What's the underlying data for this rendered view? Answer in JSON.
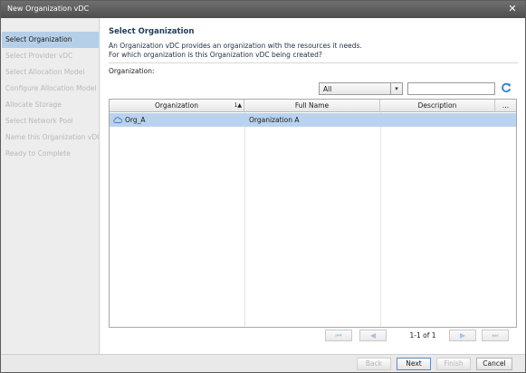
{
  "window": {
    "title": "New Organization vDC",
    "close_glyph": "✕"
  },
  "steps": [
    {
      "label": "Select Organization",
      "active": true
    },
    {
      "label": "Select Provider vDC",
      "active": false
    },
    {
      "label": "Select Allocation Model",
      "active": false
    },
    {
      "label": "Configure Allocation Model",
      "active": false
    },
    {
      "label": "Allocate Storage",
      "active": false
    },
    {
      "label": "Select Network Pool",
      "active": false
    },
    {
      "label": "Name this Organization vDC",
      "active": false
    },
    {
      "label": "Ready to Complete",
      "active": false
    }
  ],
  "main": {
    "heading": "Select Organization",
    "desc_line1": "An Organization vDC provides an organization with the resources it needs.",
    "desc_line2": "For which organization is this Organization vDC being created?",
    "org_label": "Organization:"
  },
  "filter": {
    "selected": "All",
    "arrow_glyph": "▾",
    "search_value": ""
  },
  "table": {
    "columns": [
      {
        "label": "Organization",
        "sort": "1▲"
      },
      {
        "label": "Full Name"
      },
      {
        "label": "Description"
      },
      {
        "label": "..."
      }
    ],
    "rows": [
      {
        "organization": "Org_A",
        "full_name": "Organization A",
        "description": ""
      }
    ]
  },
  "pager": {
    "info": "1-1 of 1",
    "first": "⏮",
    "prev": "◀",
    "next": "▶",
    "last": "⏭"
  },
  "buttons": {
    "back": "Back",
    "next": "Next",
    "finish": "Finish",
    "cancel": "Cancel"
  },
  "colors": {
    "selection": "#b9d3ee",
    "accent": "#2f7fd1",
    "title_bar": "#5a5a5a"
  }
}
